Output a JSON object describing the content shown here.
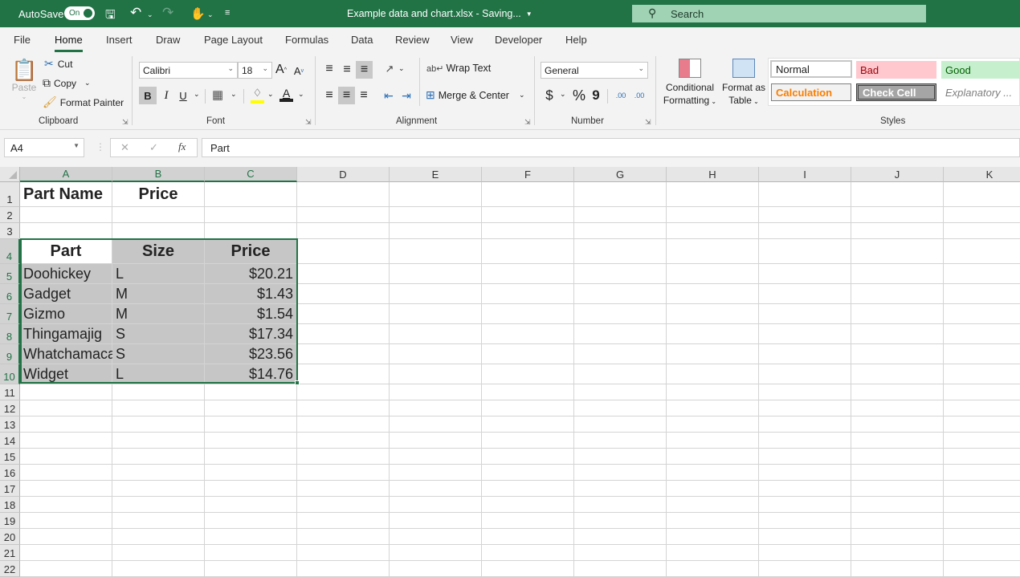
{
  "titlebar": {
    "autosave_label": "AutoSave",
    "autosave_state": "On",
    "title": "Example data and chart.xlsx  -  Saving...",
    "search_placeholder": "Search",
    "icons": [
      "save-icon",
      "undo-icon",
      "redo-icon",
      "touch-mode-icon",
      "customize-qat-icon"
    ]
  },
  "tabs": [
    "File",
    "Home",
    "Insert",
    "Draw",
    "Page Layout",
    "Formulas",
    "Data",
    "Review",
    "View",
    "Developer",
    "Help"
  ],
  "active_tab": "Home",
  "ribbon": {
    "clipboard": {
      "paste": "Paste",
      "cut": "Cut",
      "copy": "Copy",
      "format_painter": "Format Painter",
      "label": "Clipboard"
    },
    "font": {
      "name": "Calibri",
      "size": "18",
      "bold": "B",
      "italic": "I",
      "underline": "U",
      "label": "Font",
      "grow": "A",
      "shrink": "A",
      "font_color": "A"
    },
    "alignment": {
      "wrap_text": "Wrap Text",
      "merge_center": "Merge & Center",
      "label": "Alignment"
    },
    "number": {
      "format": "General",
      "currency": "$",
      "percent": "%",
      "comma": "9",
      "inc_decimal": ".00",
      "dec_decimal": ".00",
      "label": "Number"
    },
    "styles": {
      "conditional_formatting": [
        "Conditional",
        "Formatting"
      ],
      "format_as_table": [
        "Format as",
        "Table"
      ],
      "normal": "Normal",
      "bad": "Bad",
      "good": "Good",
      "calculation": "Calculation",
      "check_cell": "Check Cell",
      "explanatory": "Explanatory ...",
      "label": "Styles",
      "colors": {
        "bad_bg": "#ffc7ce",
        "bad_fg": "#9c0006",
        "good_bg": "#c6efce",
        "good_fg": "#006100",
        "calc_fg": "#fa7d00",
        "check_bg": "#a5a5a5"
      }
    }
  },
  "formula_bar": {
    "name_box": "A4",
    "formula": "Part",
    "cancel": "✕",
    "enter": "✓",
    "fx": "fx"
  },
  "columns": [
    "A",
    "B",
    "C",
    "D",
    "E",
    "F",
    "G",
    "H",
    "I",
    "J",
    "K"
  ],
  "rows": [
    "1",
    "2",
    "3",
    "4",
    "5",
    "6",
    "7",
    "8",
    "9",
    "10",
    "11",
    "12",
    "13",
    "14",
    "15",
    "16",
    "17",
    "18",
    "19",
    "20",
    "21",
    "22"
  ],
  "cells": {
    "A1": "Part Name",
    "B1": "Price",
    "A4": "Part",
    "B4": "Size",
    "C4": "Price",
    "A5": "Doohickey",
    "B5": "L",
    "C5": "$20.21",
    "A6": "Gadget",
    "B6": "M",
    "C6": "$1.43",
    "A7": "Gizmo",
    "B7": "M",
    "C7": "$1.54",
    "A8": "Thingamajig",
    "B8": "S",
    "C8": "$17.34",
    "A9": "Whatchamaca",
    "B9": "S",
    "C9": "$23.56",
    "A10": "Widget",
    "B10": "L",
    "C10": "$14.76"
  },
  "accent_color": "#217346"
}
